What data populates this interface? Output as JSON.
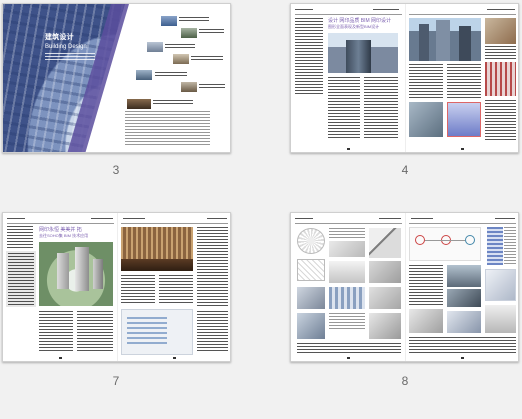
{
  "pages": [
    {
      "label": "3"
    },
    {
      "label": "4"
    },
    {
      "label": "7"
    },
    {
      "label": "8"
    }
  ],
  "cover": {
    "title_cn": "建筑设计",
    "title_en": "Building Design"
  },
  "page4": {
    "heading_line1": "设计 网印品质 BIM 网印设计",
    "heading_line2": "图形全面表现及新型BIM设计"
  },
  "page7": {
    "heading_line1": "网印永恒 美美并 拓",
    "heading_line2": "去往SOHO集 BIM 技术应用"
  },
  "colors": {
    "page_bg": "#f1f1f1",
    "cover_blue": "#3e5289",
    "accent_purple": "#5b4e9e"
  }
}
